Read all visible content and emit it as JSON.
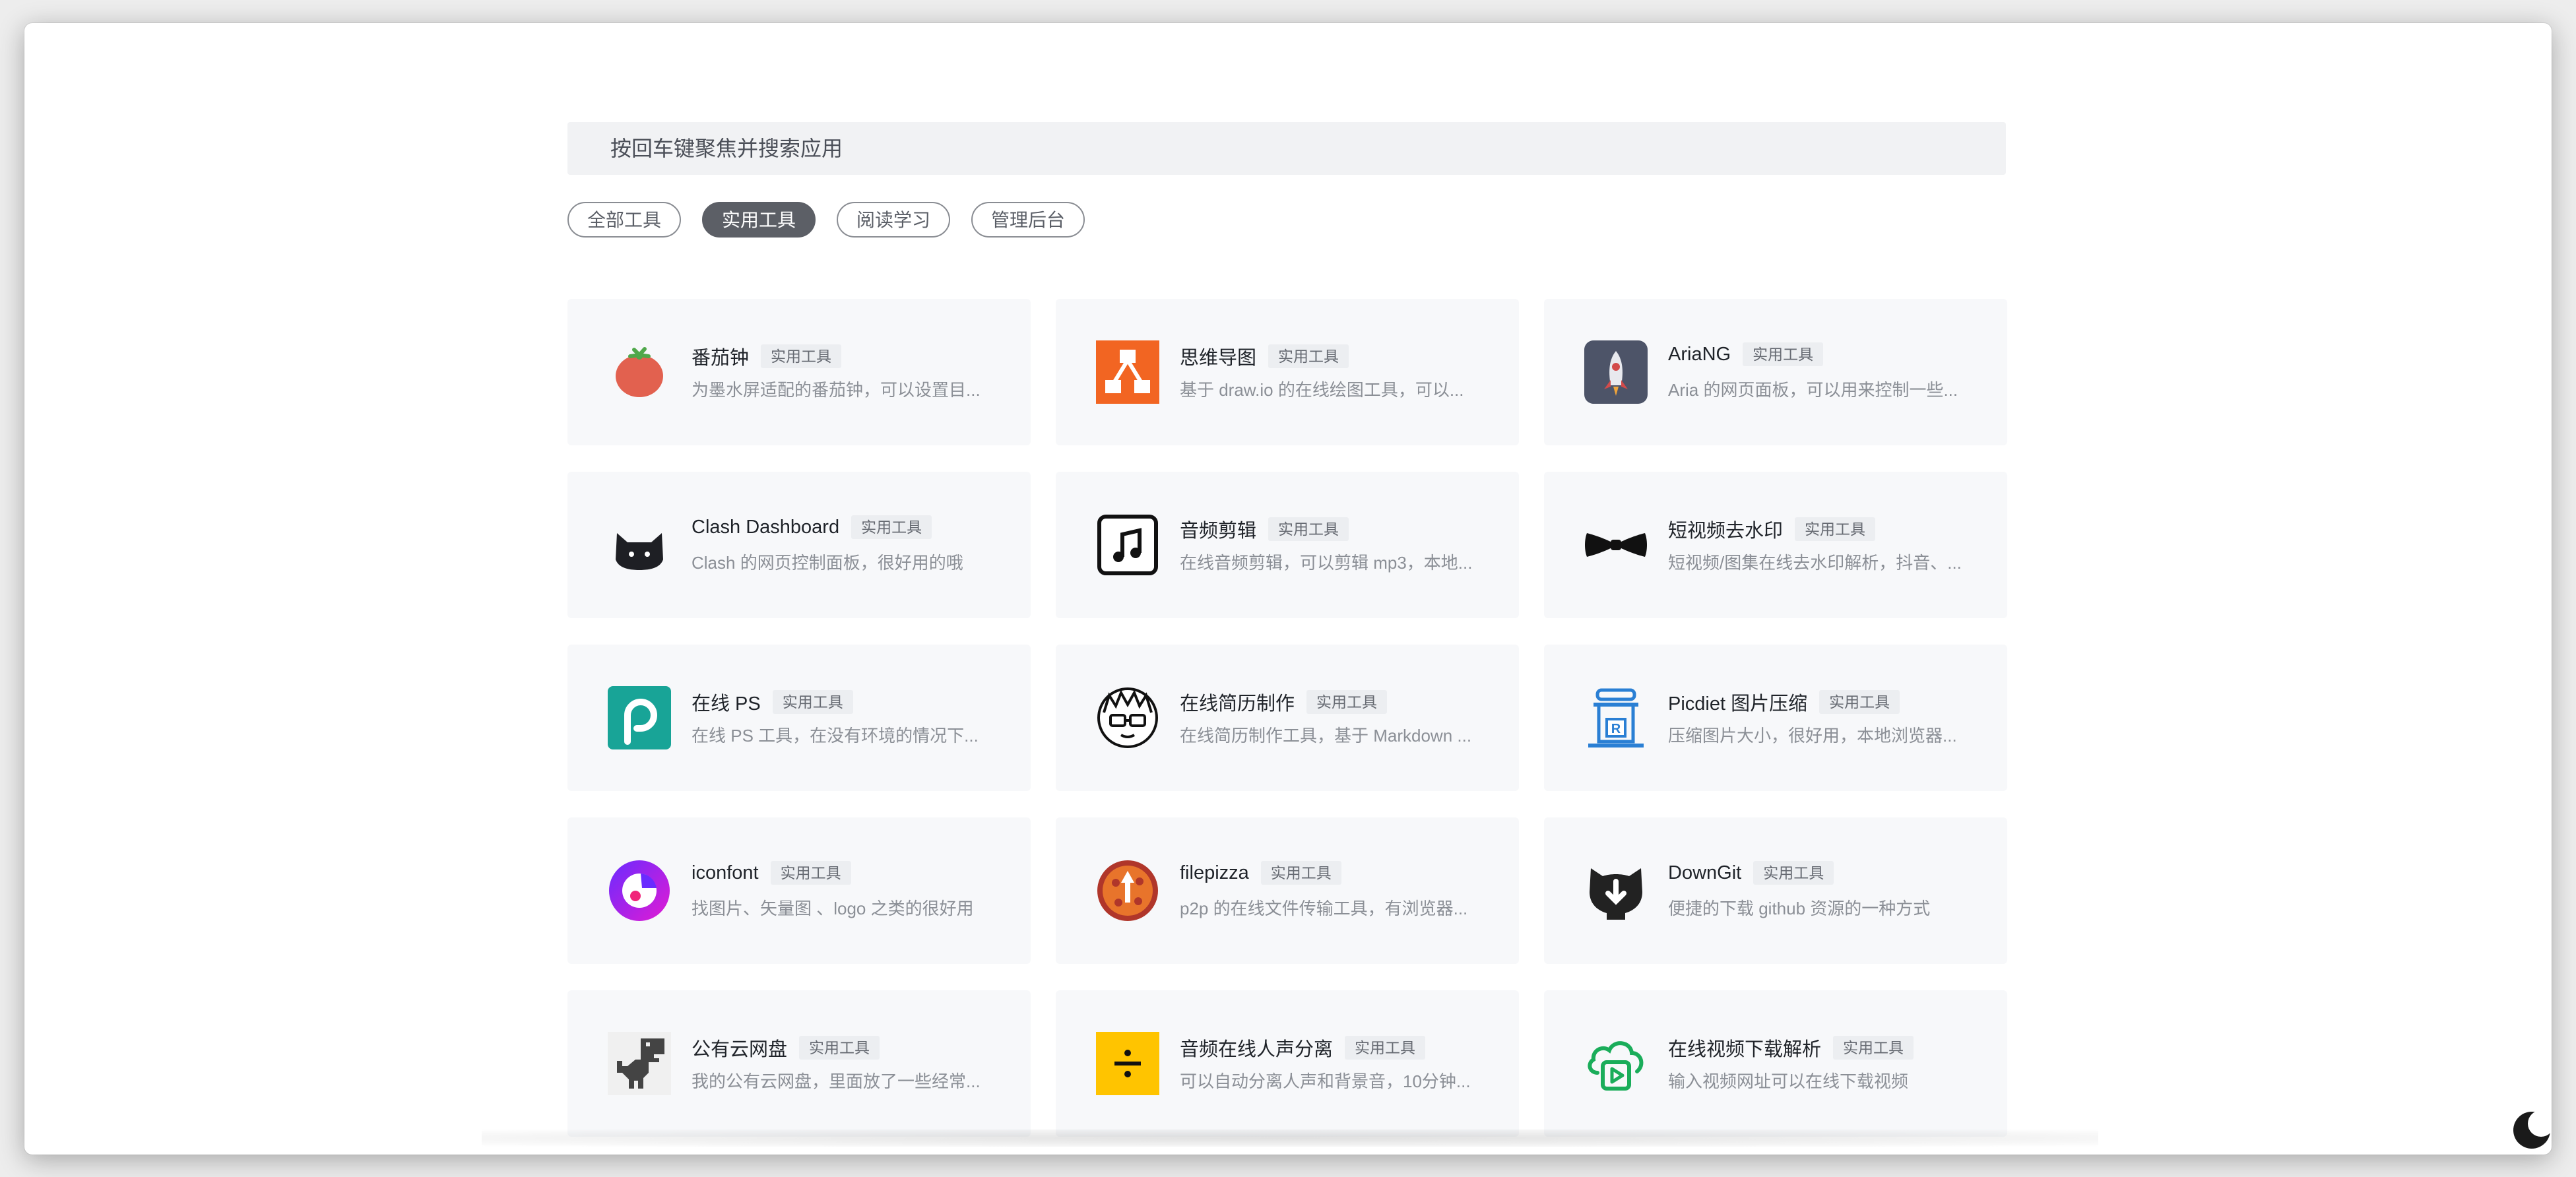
{
  "search": {
    "placeholder": "按回车键聚焦并搜索应用"
  },
  "tabs": [
    {
      "label": "全部工具",
      "active": false
    },
    {
      "label": "实用工具",
      "active": true
    },
    {
      "label": "阅读学习",
      "active": false
    },
    {
      "label": "管理后台",
      "active": false
    }
  ],
  "apps": [
    {
      "name": "番茄钟",
      "tag": "实用工具",
      "desc": "为墨水屏适配的番茄钟，可以设置目...",
      "icon": "tomato-icon"
    },
    {
      "name": "思维导图",
      "tag": "实用工具",
      "desc": "基于 draw.io 的在线绘图工具，可以...",
      "icon": "mindmap-icon"
    },
    {
      "name": "AriaNG",
      "tag": "实用工具",
      "desc": "Aria 的网页面板，可以用来控制一些...",
      "icon": "rocket-icon"
    },
    {
      "name": "Clash Dashboard",
      "tag": "实用工具",
      "desc": "Clash 的网页控制面板，很好用的哦",
      "icon": "cat-icon"
    },
    {
      "name": "音频剪辑",
      "tag": "实用工具",
      "desc": "在线音频剪辑，可以剪辑 mp3，本地...",
      "icon": "music-note-icon"
    },
    {
      "name": "短视频去水印",
      "tag": "实用工具",
      "desc": "短视频/图集在线去水印解析，抖音、...",
      "icon": "bowtie-icon"
    },
    {
      "name": "在线 PS",
      "tag": "实用工具",
      "desc": "在线 PS 工具，在没有环境的情况下...",
      "icon": "photopea-icon"
    },
    {
      "name": "在线简历制作",
      "tag": "实用工具",
      "desc": "在线简历制作工具，基于 Markdown ...",
      "icon": "avatar-glasses-icon"
    },
    {
      "name": "Picdiet 图片压缩",
      "tag": "实用工具",
      "desc": "压缩图片大小，很好用，本地浏览器...",
      "icon": "compress-jar-icon"
    },
    {
      "name": "iconfont",
      "tag": "实用工具",
      "desc": "找图片、矢量图 、logo 之类的很好用",
      "icon": "iconfont-icon"
    },
    {
      "name": "filepizza",
      "tag": "实用工具",
      "desc": "p2p 的在线文件传输工具，有浏览器...",
      "icon": "pizza-icon"
    },
    {
      "name": "DownGit",
      "tag": "实用工具",
      "desc": "便捷的下载 github 资源的一种方式",
      "icon": "downgit-icon"
    },
    {
      "name": "公有云网盘",
      "tag": "实用工具",
      "desc": "我的公有云网盘，里面放了一些经常...",
      "icon": "dino-icon"
    },
    {
      "name": "音频在线人声分离",
      "tag": "实用工具",
      "desc": "可以自动分离人声和背景音，10分钟...",
      "icon": "divide-icon"
    },
    {
      "name": "在线视频下载解析",
      "tag": "实用工具",
      "desc": "输入视频网址可以在线下载视频",
      "icon": "cloud-video-icon"
    }
  ],
  "theme_toggle": {
    "icon": "moon-icon"
  }
}
